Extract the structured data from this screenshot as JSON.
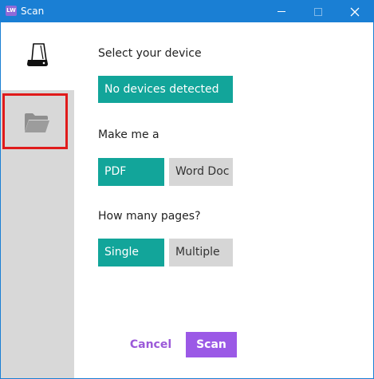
{
  "window": {
    "title": "Scan",
    "app_icon_text": "LW",
    "accent": "#1a7fd4"
  },
  "sidebar": {
    "items": [
      {
        "icon": "scanner-icon",
        "selected": true
      },
      {
        "icon": "folder-icon",
        "selected": false,
        "highlighted": true
      }
    ]
  },
  "form": {
    "device_label": "Select your device",
    "device_value": "No devices detected",
    "make_label": "Make me a",
    "format_options": [
      {
        "label": "PDF",
        "selected": true
      },
      {
        "label": "Word Doc",
        "selected": false
      }
    ],
    "pages_label": "How many pages?",
    "page_options": [
      {
        "label": "Single",
        "selected": true
      },
      {
        "label": "Multiple",
        "selected": false
      }
    ]
  },
  "actions": {
    "cancel_label": "Cancel",
    "scan_label": "Scan"
  },
  "colors": {
    "teal": "#12a59a",
    "purple": "#9b59e6",
    "highlight_red": "#e01b1b"
  }
}
